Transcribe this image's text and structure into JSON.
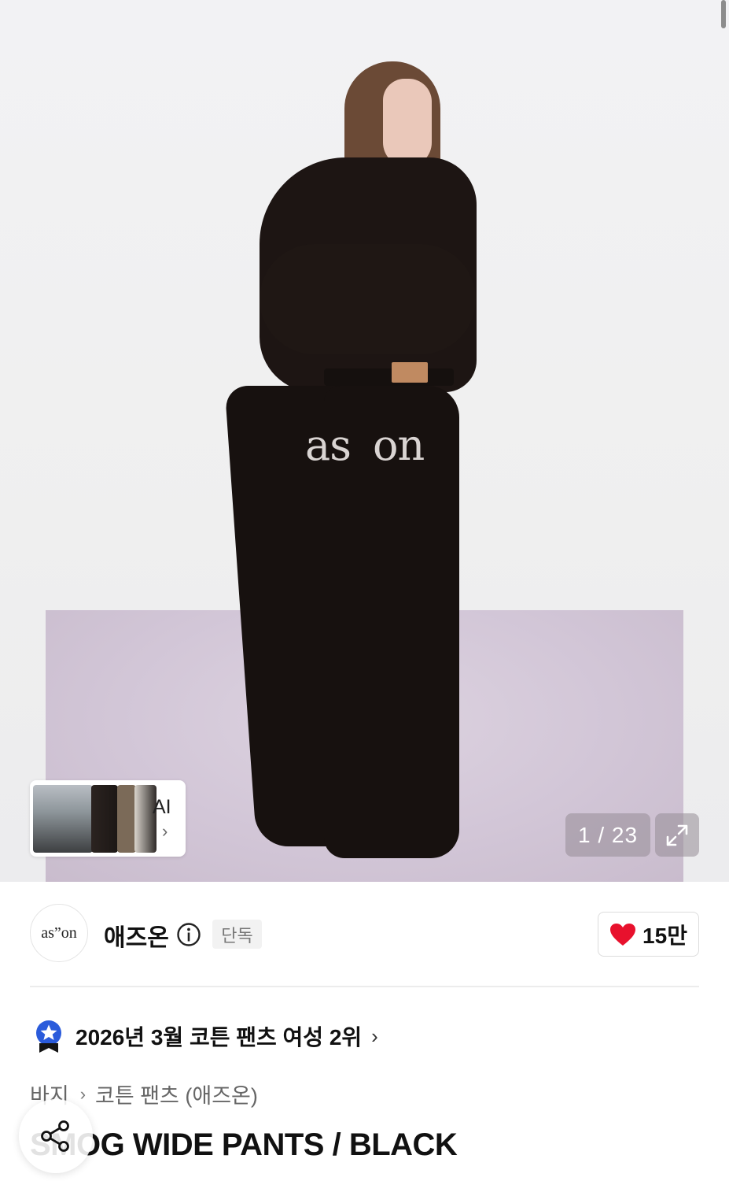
{
  "gallery": {
    "counter": "1 / 23",
    "ai_similar_label": "AI",
    "ai_chevron": "›",
    "pocket_print_left": "as",
    "pocket_print_right": "on",
    "expand_icon": "expand-icon"
  },
  "brand": {
    "logo_text": "as”on",
    "name": "애즈온",
    "badge": "단독",
    "like_count": "15만",
    "like_color": "#e8112d"
  },
  "ranking": {
    "text": "2026년 3월 코튼 팬츠 여성 2위",
    "chevron": "›",
    "badge_color": "#2a5bdb"
  },
  "breadcrumb": {
    "items": [
      "바지",
      "코튼 팬츠 (애즈온)"
    ],
    "separator": "›"
  },
  "product": {
    "title": "SMOG WIDE PANTS / BLACK"
  }
}
